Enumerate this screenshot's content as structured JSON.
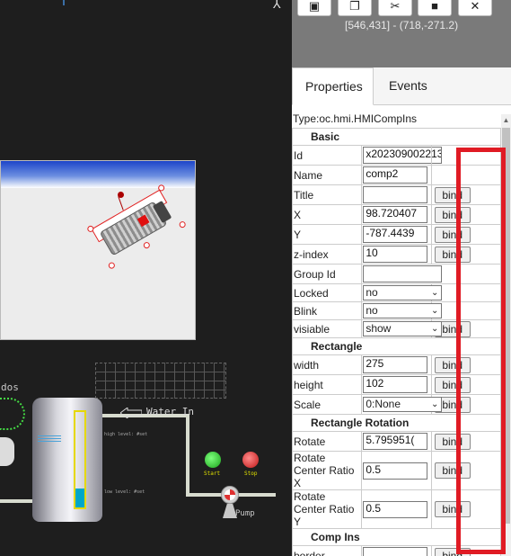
{
  "toolbar": {
    "buttons": [
      {
        "icon": "camera-icon"
      },
      {
        "icon": "copy-icon"
      },
      {
        "icon": "scissors-icon"
      },
      {
        "icon": "stop-icon"
      },
      {
        "icon": "close-icon"
      }
    ],
    "coord_line": "[546,431] - (718,-271.2)"
  },
  "canvas": {
    "label_dos": "dos",
    "water_in": "Water In",
    "high_level": "high level: #set",
    "low_level": "low level: #set",
    "start": "Start",
    "stop": "Stop",
    "pump": "Pump",
    "tank_level": 0.2
  },
  "panel": {
    "tabs": [
      {
        "label": "Properties"
      },
      {
        "label": "Events"
      }
    ],
    "type_line": "Type:oc.hmi.HMICompIns",
    "bind_label": "bind",
    "sections": {
      "basic": "Basic",
      "rectangle": "Rectangle",
      "rectangle_rotation": "Rectangle Rotation",
      "comp_ins": "Comp Ins"
    },
    "rows": {
      "id": {
        "label": "Id",
        "value": "x202309002213"
      },
      "name": {
        "label": "Name",
        "value": "comp2"
      },
      "title": {
        "label": "Title",
        "value": ""
      },
      "x": {
        "label": "X",
        "value": "98.720407"
      },
      "y": {
        "label": "Y",
        "value": "-787.4439"
      },
      "zindex": {
        "label": "z-index",
        "value": "10"
      },
      "group_id": {
        "label": "Group Id",
        "value": ""
      },
      "locked": {
        "label": "Locked",
        "value": "no"
      },
      "blink": {
        "label": "Blink",
        "value": "no"
      },
      "visiable": {
        "label": "visiable",
        "value": "show"
      },
      "width": {
        "label": "width",
        "value": "275"
      },
      "height": {
        "label": "height",
        "value": "102"
      },
      "scale": {
        "label": "Scale",
        "value": "0:None"
      },
      "rotate": {
        "label": "Rotate",
        "value": "5.795951("
      },
      "rcrx": {
        "label": "Rotate Center Ratio X",
        "value": "0.5"
      },
      "rcry": {
        "label": "Rotate Center Ratio Y",
        "value": "0.5"
      },
      "border": {
        "label": "border",
        "value": ""
      }
    }
  },
  "colors": {
    "highlight_box": "#e01b24",
    "toolbar_bg": "#7a7a7a",
    "canvas_bg": "#1e1e1e"
  }
}
